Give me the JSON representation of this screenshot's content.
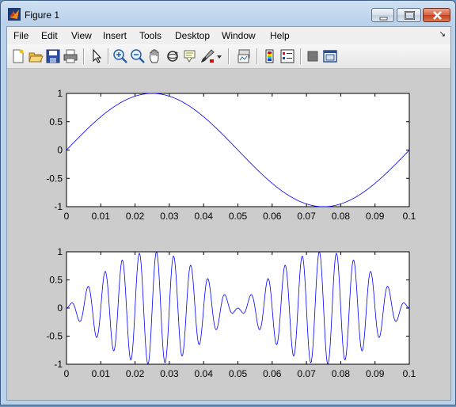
{
  "window": {
    "title": "Figure 1"
  },
  "menubar": {
    "items": [
      "File",
      "Edit",
      "View",
      "Insert",
      "Tools",
      "Desktop",
      "Window",
      "Help"
    ]
  },
  "toolbar": {
    "icons": [
      "new-figure-icon",
      "open-file-icon",
      "save-icon",
      "print-icon",
      "pointer-icon",
      "zoom-in-icon",
      "zoom-out-icon",
      "pan-icon",
      "rotate-3d-icon",
      "data-cursor-icon",
      "brush-icon",
      "link-plot-icon",
      "insert-colorbar-icon",
      "insert-legend-icon",
      "hide-plot-tools-icon",
      "show-plot-tools-icon"
    ]
  },
  "chart_data": [
    {
      "type": "line",
      "function": "sin(2*pi*10*t)",
      "x_range": [
        0,
        0.1
      ],
      "x_ticks": [
        "0",
        "0.01",
        "0.02",
        "0.03",
        "0.04",
        "0.05",
        "0.06",
        "0.07",
        "0.08",
        "0.09",
        "0.1"
      ],
      "y_ticks": [
        "1",
        "0.5",
        "0",
        "-0.5",
        "-1"
      ],
      "xlim": [
        0,
        0.1
      ],
      "ylim": [
        -1,
        1
      ],
      "color": "#0000ff"
    },
    {
      "type": "line",
      "function": "sin(2*pi*10*t) * sin(2*pi*200*t)",
      "x_range": [
        0,
        0.1
      ],
      "x_ticks": [
        "0",
        "0.01",
        "0.02",
        "0.03",
        "0.04",
        "0.05",
        "0.06",
        "0.07",
        "0.08",
        "0.09",
        "0.1"
      ],
      "y_ticks": [
        "1",
        "0.5",
        "0",
        "-0.5",
        "-1"
      ],
      "xlim": [
        0,
        0.1
      ],
      "ylim": [
        -1,
        1
      ],
      "color": "#0000ff"
    }
  ]
}
